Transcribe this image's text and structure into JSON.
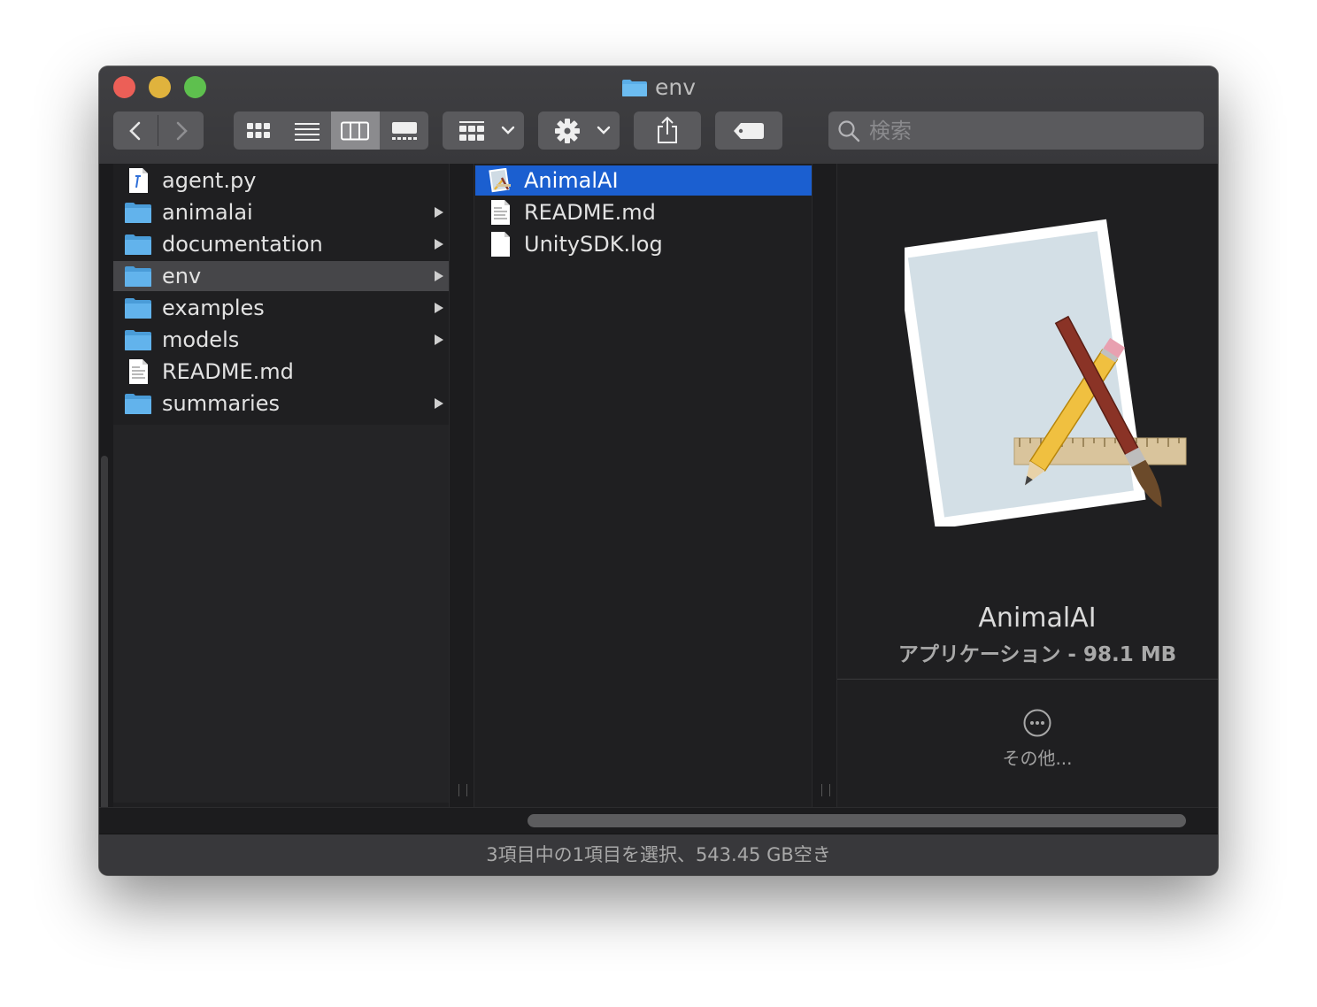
{
  "window": {
    "title": "env"
  },
  "toolbar": {
    "back_label": "back",
    "forward_label": "forward",
    "search_placeholder": "検索"
  },
  "columns": {
    "first": [
      {
        "name": "agent.py",
        "type": "python",
        "has_children": false
      },
      {
        "name": "animalai",
        "type": "folder",
        "has_children": true
      },
      {
        "name": "documentation",
        "type": "folder",
        "has_children": true
      },
      {
        "name": "env",
        "type": "folder",
        "has_children": true,
        "selected": true
      },
      {
        "name": "examples",
        "type": "folder",
        "has_children": true
      },
      {
        "name": "models",
        "type": "folder",
        "has_children": true
      },
      {
        "name": "README.md",
        "type": "markdown",
        "has_children": false
      },
      {
        "name": "summaries",
        "type": "folder",
        "has_children": true
      }
    ],
    "second": [
      {
        "name": "AnimalAI",
        "type": "app",
        "selected": true
      },
      {
        "name": "README.md",
        "type": "markdown"
      },
      {
        "name": "UnitySDK.log",
        "type": "file"
      }
    ]
  },
  "preview": {
    "name": "AnimalAI",
    "info": "アプリケーション - 98.1 MB",
    "more_label": "その他..."
  },
  "status": "3項目中の1項目を選択、543.45 GB空き",
  "colors": {
    "selection_blue": "#1b5fd0",
    "folder_blue": "#5aaee8",
    "background": "#1f1f21"
  }
}
